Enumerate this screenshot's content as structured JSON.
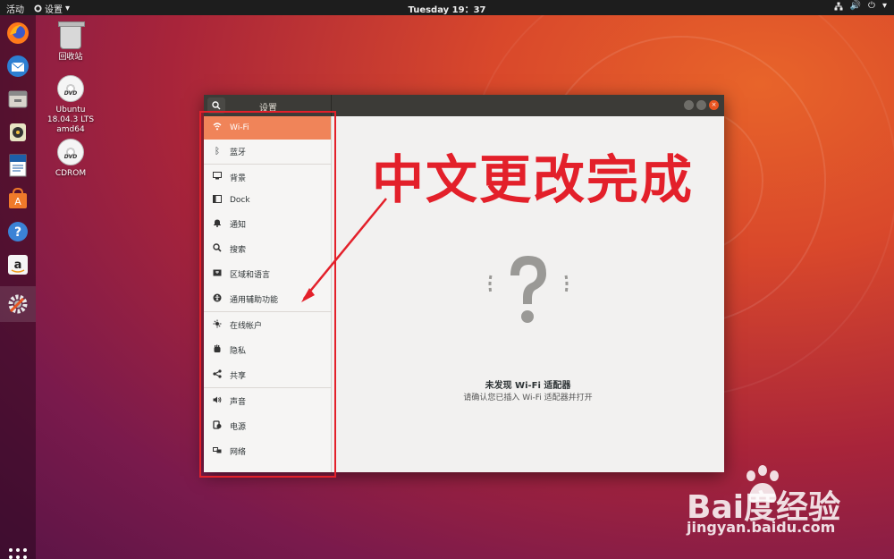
{
  "topbar": {
    "activities": "活动",
    "app_menu": "设置",
    "clock": "Tuesday 19：37"
  },
  "desktop_icons": [
    {
      "label": "回收站"
    },
    {
      "label": "Ubuntu 18.04.3 LTS amd64"
    },
    {
      "label": "CDROM"
    }
  ],
  "dock": {
    "items": [
      "firefox-icon",
      "thunderbird-icon",
      "files-icon",
      "rhythmbox-icon",
      "writer-icon",
      "software-icon",
      "help-icon",
      "amazon-icon",
      "settings-icon"
    ]
  },
  "window": {
    "title": "设置",
    "sidebar": {
      "items": [
        {
          "label": "Wi-Fi",
          "icon": "wifi-icon"
        },
        {
          "label": "蓝牙",
          "icon": "bluetooth-icon"
        },
        {
          "label": "背景",
          "icon": "background-icon"
        },
        {
          "label": "Dock",
          "icon": "dock-icon"
        },
        {
          "label": "通知",
          "icon": "bell-icon"
        },
        {
          "label": "搜索",
          "icon": "search-icon"
        },
        {
          "label": "区域和语言",
          "icon": "flag-icon"
        },
        {
          "label": "通用辅助功能",
          "icon": "accessibility-icon"
        },
        {
          "label": "在线帐户",
          "icon": "online-accounts-icon"
        },
        {
          "label": "隐私",
          "icon": "hand-icon"
        },
        {
          "label": "共享",
          "icon": "share-icon"
        },
        {
          "label": "声音",
          "icon": "speaker-icon"
        },
        {
          "label": "电源",
          "icon": "power-icon"
        },
        {
          "label": "网络",
          "icon": "network-icon"
        }
      ]
    },
    "content": {
      "empty_title": "未发现 Wi-Fi 适配器",
      "empty_subtitle": "请确认您已插入 Wi-Fi 适配器并打开"
    }
  },
  "annotation": {
    "text": "中文更改完成",
    "color": "#e3202a"
  },
  "watermark": {
    "brand": "Bai度经验",
    "url": "jingyan.baidu.com"
  },
  "colors": {
    "accent": "#e95420",
    "selected": "#f08459",
    "titlebar": "#3c3b37"
  }
}
